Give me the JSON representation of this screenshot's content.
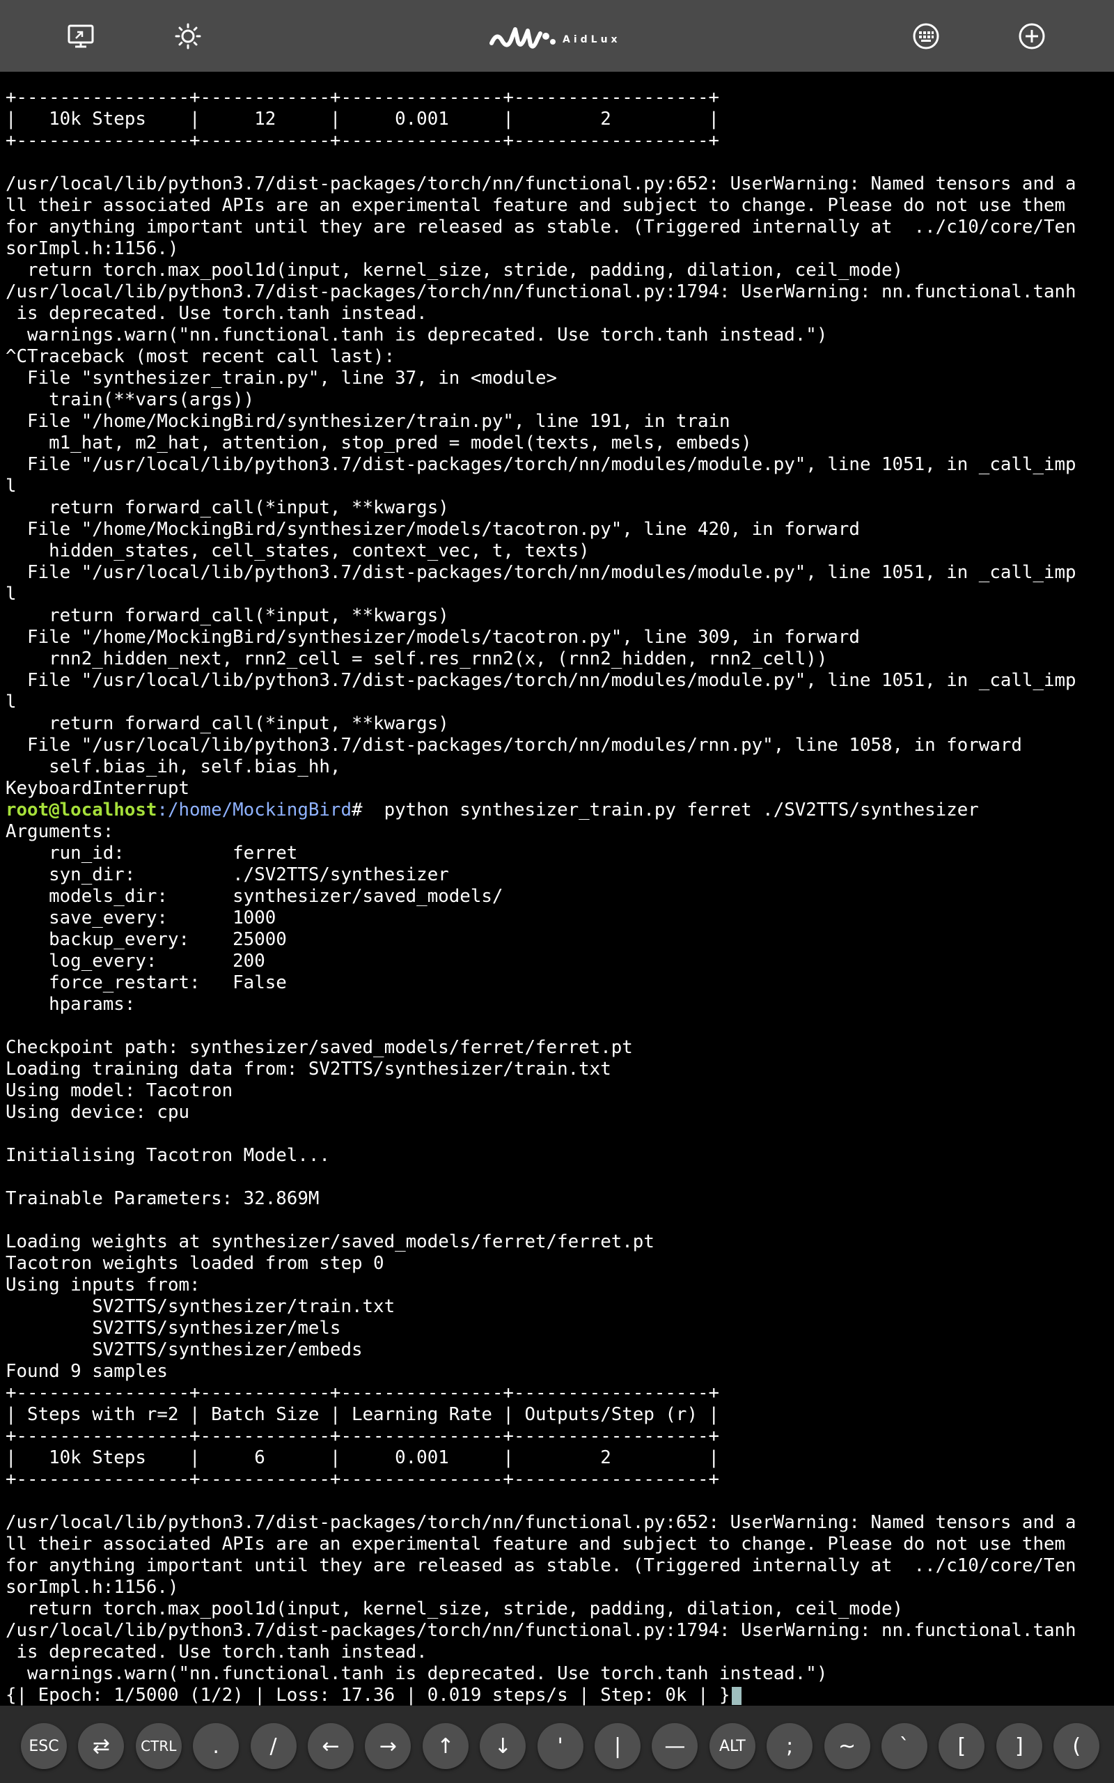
{
  "app": {
    "brand": "AidLux"
  },
  "toolbar": {
    "left_icons": [
      "desktop-icon",
      "brightness-icon"
    ],
    "right_icons": [
      "keyboard-icon",
      "add-circle-icon"
    ]
  },
  "terminal": {
    "lines": [
      "+----------------+------------+---------------+------------------+",
      "|   10k Steps    |     12     |     0.001     |        2         |",
      "+----------------+------------+---------------+------------------+",
      "",
      "/usr/local/lib/python3.7/dist-packages/torch/nn/functional.py:652: UserWarning: Named tensors and a",
      "ll their associated APIs are an experimental feature and subject to change. Please do not use them",
      "for anything important until they are released as stable. (Triggered internally at  ../c10/core/Ten",
      "sorImpl.h:1156.)",
      "  return torch.max_pool1d(input, kernel_size, stride, padding, dilation, ceil_mode)",
      "/usr/local/lib/python3.7/dist-packages/torch/nn/functional.py:1794: UserWarning: nn.functional.tanh",
      " is deprecated. Use torch.tanh instead.",
      "  warnings.warn(\"nn.functional.tanh is deprecated. Use torch.tanh instead.\")",
      "^CTraceback (most recent call last):",
      "  File \"synthesizer_train.py\", line 37, in <module>",
      "    train(**vars(args))",
      "  File \"/home/MockingBird/synthesizer/train.py\", line 191, in train",
      "    m1_hat, m2_hat, attention, stop_pred = model(texts, mels, embeds)",
      "  File \"/usr/local/lib/python3.7/dist-packages/torch/nn/modules/module.py\", line 1051, in _call_imp",
      "l",
      "    return forward_call(*input, **kwargs)",
      "  File \"/home/MockingBird/synthesizer/models/tacotron.py\", line 420, in forward",
      "    hidden_states, cell_states, context_vec, t, texts)",
      "  File \"/usr/local/lib/python3.7/dist-packages/torch/nn/modules/module.py\", line 1051, in _call_imp",
      "l",
      "    return forward_call(*input, **kwargs)",
      "  File \"/home/MockingBird/synthesizer/models/tacotron.py\", line 309, in forward",
      "    rnn2_hidden_next, rnn2_cell = self.res_rnn2(x, (rnn2_hidden, rnn2_cell))",
      "  File \"/usr/local/lib/python3.7/dist-packages/torch/nn/modules/module.py\", line 1051, in _call_imp",
      "l",
      "    return forward_call(*input, **kwargs)",
      "  File \"/usr/local/lib/python3.7/dist-packages/torch/nn/modules/rnn.py\", line 1058, in forward",
      "    self.bias_ih, self.bias_hh,",
      "KeyboardInterrupt"
    ],
    "prompt": {
      "user_host": "root@localhost",
      "path": ":/home/MockingBird",
      "symbol": "# ",
      "command": " python synthesizer_train.py ferret ./SV2TTS/synthesizer"
    },
    "lines_after": [
      "Arguments:",
      "    run_id:          ferret",
      "    syn_dir:         ./SV2TTS/synthesizer",
      "    models_dir:      synthesizer/saved_models/",
      "    save_every:      1000",
      "    backup_every:    25000",
      "    log_every:       200",
      "    force_restart:   False",
      "    hparams:",
      "",
      "Checkpoint path: synthesizer/saved_models/ferret/ferret.pt",
      "Loading training data from: SV2TTS/synthesizer/train.txt",
      "Using model: Tacotron",
      "Using device: cpu",
      "",
      "Initialising Tacotron Model...",
      "",
      "Trainable Parameters: 32.869M",
      "",
      "Loading weights at synthesizer/saved_models/ferret/ferret.pt",
      "Tacotron weights loaded from step 0",
      "Using inputs from:",
      "        SV2TTS/synthesizer/train.txt",
      "        SV2TTS/synthesizer/mels",
      "        SV2TTS/synthesizer/embeds",
      "Found 9 samples",
      "+----------------+------------+---------------+------------------+",
      "| Steps with r=2 | Batch Size | Learning Rate | Outputs/Step (r) |",
      "+----------------+------------+---------------+------------------+",
      "|   10k Steps    |     6      |     0.001     |        2         |",
      "+----------------+------------+---------------+------------------+",
      "",
      "/usr/local/lib/python3.7/dist-packages/torch/nn/functional.py:652: UserWarning: Named tensors and a",
      "ll their associated APIs are an experimental feature and subject to change. Please do not use them",
      "for anything important until they are released as stable. (Triggered internally at  ../c10/core/Ten",
      "sorImpl.h:1156.)",
      "  return torch.max_pool1d(input, kernel_size, stride, padding, dilation, ceil_mode)",
      "/usr/local/lib/python3.7/dist-packages/torch/nn/functional.py:1794: UserWarning: nn.functional.tanh",
      " is deprecated. Use torch.tanh instead.",
      "  warnings.warn(\"nn.functional.tanh is deprecated. Use torch.tanh instead.\")"
    ],
    "last_line": "{| Epoch: 1/5000 (1/2) | Loss: 17.36 | 0.019 steps/s | Step: 0k | }"
  },
  "keys": [
    {
      "label": "ESC",
      "name": "key-esc"
    },
    {
      "label": "⇄",
      "name": "key-tab"
    },
    {
      "label": "CTRL",
      "name": "key-ctrl"
    },
    {
      "label": ".",
      "name": "key-period"
    },
    {
      "label": "/",
      "name": "key-slash"
    },
    {
      "label": "←",
      "name": "key-left"
    },
    {
      "label": "→",
      "name": "key-right"
    },
    {
      "label": "↑",
      "name": "key-up"
    },
    {
      "label": "↓",
      "name": "key-down"
    },
    {
      "label": "'",
      "name": "key-quote"
    },
    {
      "label": "|",
      "name": "key-pipe"
    },
    {
      "label": "—",
      "name": "key-dash"
    },
    {
      "label": "ALT",
      "name": "key-alt"
    },
    {
      "label": ";",
      "name": "key-semicolon"
    },
    {
      "label": "~",
      "name": "key-tilde"
    },
    {
      "label": "`",
      "name": "key-backtick"
    },
    {
      "label": "[",
      "name": "key-bracket-left"
    },
    {
      "label": "]",
      "name": "key-bracket-right"
    },
    {
      "label": "(",
      "name": "key-paren-left"
    }
  ]
}
